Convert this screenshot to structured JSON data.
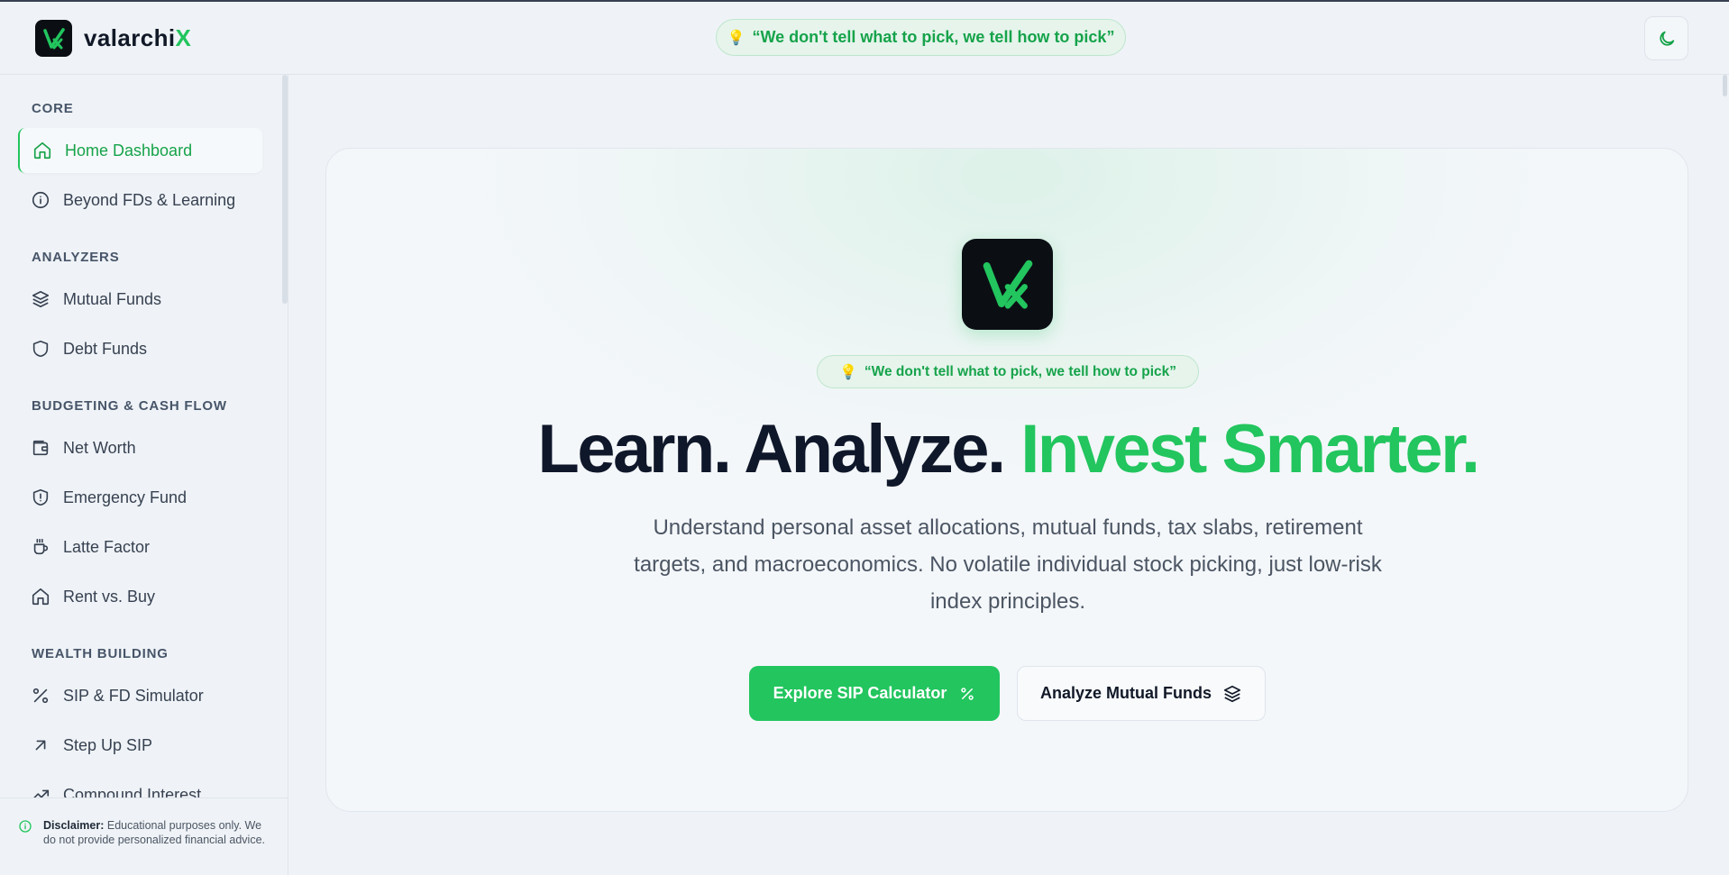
{
  "header": {
    "brand_prefix": "valarchi",
    "brand_suffix": "X",
    "tagline": "“We don't tell what to pick, we tell how to pick”",
    "theme_toggle_icon": "moon-icon"
  },
  "sidebar": {
    "sections": [
      {
        "title": "CORE",
        "items": [
          {
            "label": "Home Dashboard",
            "icon": "home-icon",
            "active": true
          },
          {
            "label": "Beyond FDs & Learning",
            "icon": "info-icon"
          }
        ]
      },
      {
        "title": "ANALYZERS",
        "items": [
          {
            "label": "Mutual Funds",
            "icon": "layers-icon"
          },
          {
            "label": "Debt Funds",
            "icon": "shield-icon"
          }
        ]
      },
      {
        "title": "BUDGETING & CASH FLOW",
        "items": [
          {
            "label": "Net Worth",
            "icon": "wallet-icon"
          },
          {
            "label": "Emergency Fund",
            "icon": "shield-alert-icon"
          },
          {
            "label": "Latte Factor",
            "icon": "coffee-icon"
          },
          {
            "label": "Rent vs. Buy",
            "icon": "home-icon"
          }
        ]
      },
      {
        "title": "WEALTH BUILDING",
        "items": [
          {
            "label": "SIP & FD Simulator",
            "icon": "percent-icon"
          },
          {
            "label": "Step Up SIP",
            "icon": "arrow-up-right-icon"
          },
          {
            "label": "Compound Interest",
            "icon": "trending-up-icon"
          }
        ]
      }
    ],
    "disclaimer_label": "Disclaimer:",
    "disclaimer_text": " Educational purposes only. We do not provide personalized financial advice."
  },
  "hero": {
    "tagline": "“We don't tell what to pick, we tell how to pick”",
    "headline_dark": "Learn. Analyze. ",
    "headline_green": "Invest Smarter.",
    "subtext": "Understand personal asset allocations, mutual funds, tax slabs, retirement targets, and macroeconomics. No volatile individual stock picking, just low-risk index principles.",
    "primary_button": "Explore SIP Calculator",
    "secondary_button": "Analyze Mutual Funds"
  },
  "colors": {
    "accent": "#22c55e",
    "accent_dark": "#16a34a",
    "background": "#eff3f7",
    "text_dark": "#0f172a"
  }
}
